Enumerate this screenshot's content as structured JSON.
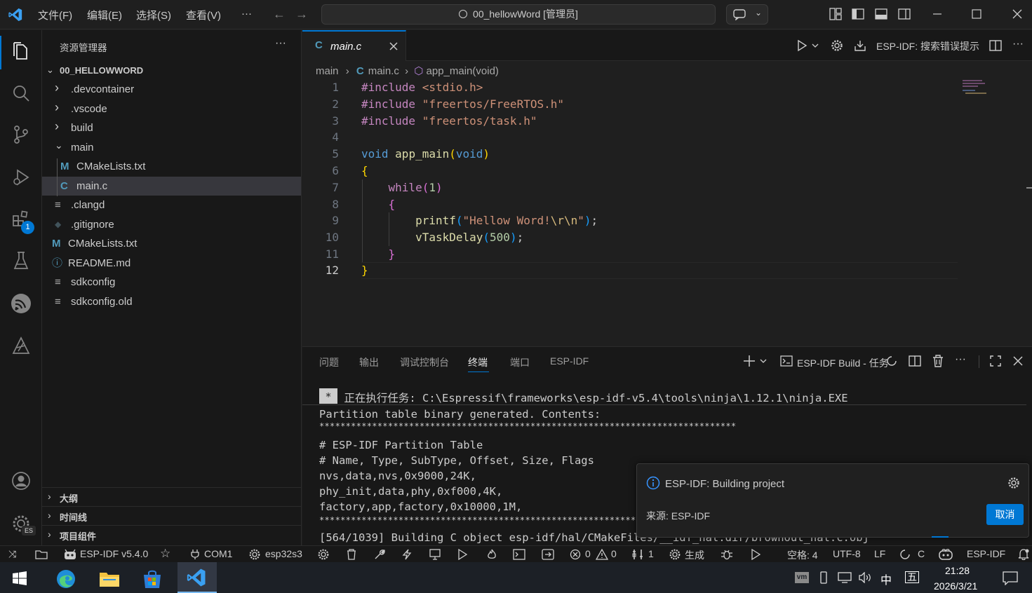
{
  "titlebar": {
    "menus": [
      "文件(F)",
      "编辑(E)",
      "选择(S)",
      "查看(V)",
      "···"
    ],
    "search_text": "00_hellowWord [管理员]"
  },
  "sidebar": {
    "title": "资源管理器",
    "root": "00_HELLOWWORD",
    "items": [
      {
        "label": ".devcontainer",
        "icon": "chevron-right-icon"
      },
      {
        "label": ".vscode",
        "icon": "chevron-right-icon"
      },
      {
        "label": "build",
        "icon": "chevron-right-icon"
      },
      {
        "label": "main",
        "icon": "chevron-down-icon"
      },
      {
        "label": "CMakeLists.txt",
        "icon": "M"
      },
      {
        "label": "main.c",
        "icon": "C"
      },
      {
        "label": ".clangd",
        "icon": "lines-icon"
      },
      {
        "label": ".gitignore",
        "icon": "diamond-icon"
      },
      {
        "label": "CMakeLists.txt",
        "icon": "M"
      },
      {
        "label": "README.md",
        "icon": "info-icon"
      },
      {
        "label": "sdkconfig",
        "icon": "lines-icon"
      },
      {
        "label": "sdkconfig.old",
        "icon": "lines-icon"
      }
    ],
    "sections": [
      "大纲",
      "时间线",
      "项目组件"
    ]
  },
  "activity": {
    "badge": "1"
  },
  "editor": {
    "tab": "main.c",
    "tab_icon": "C",
    "toolbar_text": "ESP-IDF: 搜索错误提示",
    "breadcrumb": [
      "main",
      "main.c",
      "app_main(void)"
    ],
    "lines": [
      "1",
      "2",
      "3",
      "4",
      "5",
      "6",
      "7",
      "8",
      "9",
      "10",
      "11",
      "12"
    ]
  },
  "panel": {
    "tabs": [
      "问题",
      "输出",
      "调试控制台",
      "终端",
      "端口",
      "ESP-IDF"
    ],
    "active_tab": "终端",
    "terminal_name": "ESP-IDF Build - 任务",
    "task_badge": "*",
    "task_line": " 正在执行任务: C:\\Espressif\\frameworks\\esp-idf-v5.4\\tools\\ninja\\1.12.1\\ninja.EXE",
    "output": [
      "Partition table binary generated. Contents:",
      "*******************************************************************************",
      "# ESP-IDF Partition Table",
      "# Name, Type, SubType, Offset, Size, Flags",
      "nvs,data,nvs,0x9000,24K,",
      "phy_init,data,phy,0xf000,4K,",
      "factory,app,factory,0x10000,1M,",
      "*******************************************************************************",
      "[564/1039] Building C object esp-idf/hal/CMakeFiles/__idf_hal.dir/brownout_hal.c.obj"
    ]
  },
  "toast": {
    "message": "ESP-IDF: Building project",
    "source": "来源: ESP-IDF",
    "cancel": "取消"
  },
  "statusbar": {
    "idf_version": "ESP-IDF v5.4.0",
    "port": "COM1",
    "target": "esp32s3",
    "errors": "0",
    "warnings": "0",
    "count": "1",
    "build": "生成",
    "spaces": "空格: 4",
    "encoding": "UTF-8",
    "eol": "LF",
    "lang": "C",
    "idf": "ESP-IDF"
  },
  "taskbar": {
    "time": "21:28",
    "date": "2026/3/21",
    "ime1": "中",
    "ime2": "五"
  },
  "colors": {
    "accent": "#0078d4",
    "keyword": "#569cd6",
    "include": "#c586c0",
    "string": "#ce9178",
    "function": "#dcdcaa",
    "number": "#b5cea8",
    "bracket1": "#ffd700",
    "bracket2": "#da70d6"
  }
}
